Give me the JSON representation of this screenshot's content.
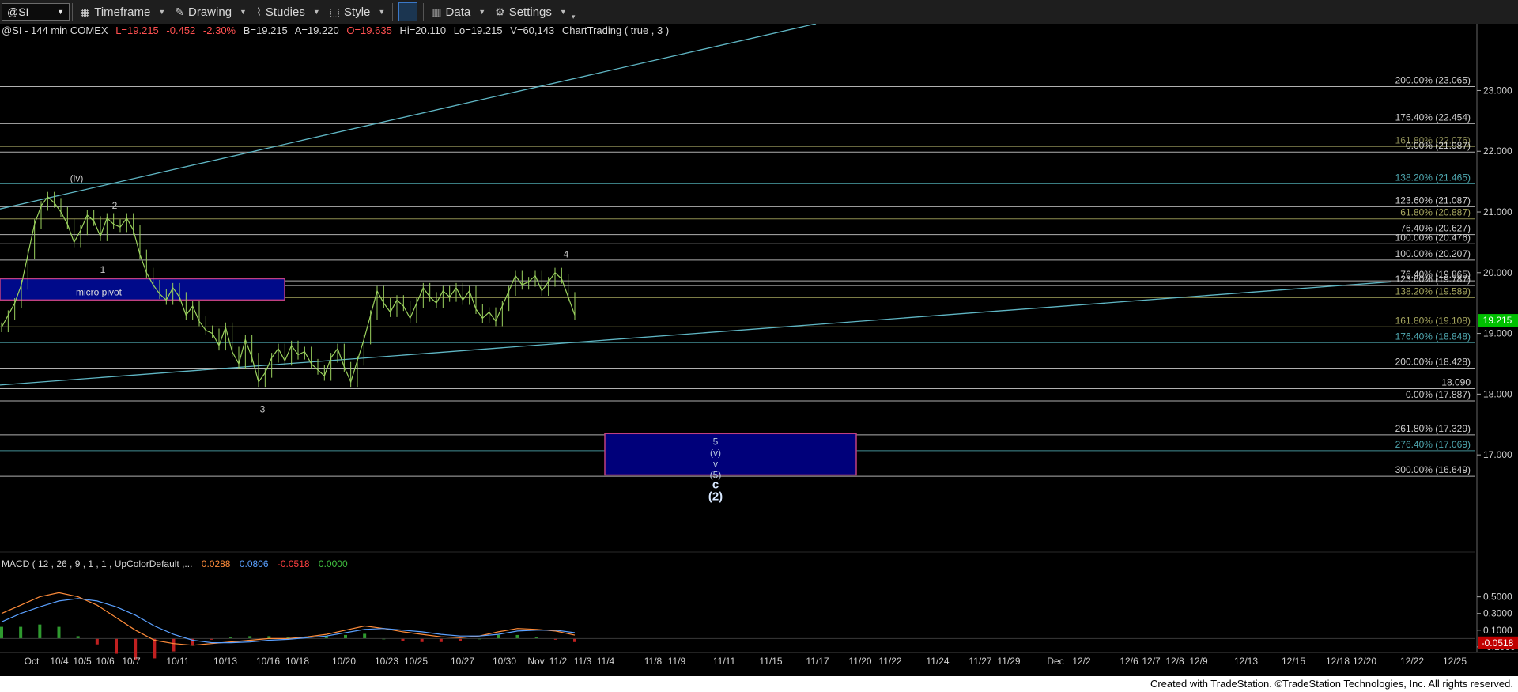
{
  "toolbar": {
    "symbol": "@SI",
    "items": [
      {
        "label": "Timeframe",
        "icon": "calendar-icon"
      },
      {
        "label": "Drawing",
        "icon": "pencil-icon"
      },
      {
        "label": "Studies",
        "icon": "studies-icon"
      },
      {
        "label": "Style",
        "icon": "style-icon"
      },
      {
        "label": "Data",
        "icon": "data-icon"
      },
      {
        "label": "Settings",
        "icon": "gear-icon"
      }
    ]
  },
  "footer": "Created with TradeStation. ©TradeStation Technologies, Inc. All rights reserved.",
  "chart_data": {
    "type": "line",
    "header": {
      "symbol": "@SI - 144 min  COMEX",
      "last": "L=19.215",
      "change": "-0.452",
      "pct": "-2.30%",
      "bid": "B=19.215",
      "ask": "A=19.220",
      "open": "O=19.635",
      "high": "Hi=20.110",
      "low": "Lo=19.215",
      "volume": "V=60,143",
      "study": "ChartTrading ( true , 3 )"
    },
    "colors": {
      "up": "#9bd25e",
      "down": "#e04040",
      "cyan": "#5fb6c4",
      "price_box": "#00c000"
    },
    "ylim": [
      15.4,
      24.1
    ],
    "x_labels": [
      "Oct",
      "10/4",
      "10/5",
      "10/6",
      "10/7",
      "10/11",
      "10/13",
      "10/16",
      "10/18",
      "10/20",
      "10/23",
      "10/25",
      "10/27",
      "10/30",
      "Nov",
      "11/2",
      "11/3",
      "11/4",
      "11/8",
      "11/9",
      "11/11",
      "11/15",
      "11/17",
      "11/20",
      "11/22",
      "11/24",
      "11/27",
      "11/29",
      "Dec",
      "12/2",
      "12/6",
      "12/7",
      "12/8",
      "12/9",
      "12/13",
      "12/15",
      "12/18",
      "12/20",
      "12/22",
      "12/25"
    ],
    "y_ticks": [
      "23.000",
      "22.000",
      "21.000",
      "20.000",
      "19.000",
      "18.000",
      "17.000"
    ],
    "current_price": "19.215",
    "fib_levels": [
      {
        "label": "200.00% (23.065)",
        "value": 23.065,
        "color": "#d0d0d0"
      },
      {
        "label": "176.40% (22.454)",
        "value": 22.454,
        "color": "#d0d0d0"
      },
      {
        "label": "161.80% (22.076)",
        "value": 22.076,
        "color": "#8a8a55"
      },
      {
        "label": "0.00% (21.987)",
        "value": 21.987,
        "color": "#d0d0d0"
      },
      {
        "label": "138.20% (21.465)",
        "value": 21.465,
        "color": "#4fa8b0"
      },
      {
        "label": "123.60% (21.087)",
        "value": 21.087,
        "color": "#d0d0d0"
      },
      {
        "label": "61.80% (20.887)",
        "value": 20.887,
        "color": "#a8a860"
      },
      {
        "label": "76.40% (20.627)",
        "value": 20.627,
        "color": "#d0d0d0"
      },
      {
        "label": "100.00% (20.476)",
        "value": 20.476,
        "color": "#d0d0d0"
      },
      {
        "label": "100.00% (20.207)",
        "value": 20.207,
        "color": "#d0d0d0"
      },
      {
        "label": "76.40% (19.865)",
        "value": 19.865,
        "color": "#d0d0d0"
      },
      {
        "label": "123.60% (19.787)",
        "value": 19.787,
        "color": "#d0d0d0"
      },
      {
        "label": "138.20% (19.589)",
        "value": 19.589,
        "color": "#a8a860"
      },
      {
        "label": "161.80% (19.108)",
        "value": 19.108,
        "color": "#a8a860"
      },
      {
        "label": "176.40% (18.848)",
        "value": 18.848,
        "color": "#4fa8b0"
      },
      {
        "label": "200.00% (18.428)",
        "value": 18.428,
        "color": "#d0d0d0"
      },
      {
        "label": "18.090",
        "value": 18.09,
        "color": "#d0d0d0"
      },
      {
        "label": "0.00% (17.887)",
        "value": 17.887,
        "color": "#d0d0d0"
      },
      {
        "label": "261.80% (17.329)",
        "value": 17.329,
        "color": "#d0d0d0"
      },
      {
        "label": "276.40% (17.069)",
        "value": 17.069,
        "color": "#4fa8b0"
      },
      {
        "label": "300.00% (16.649)",
        "value": 16.649,
        "color": "#d0d0d0"
      }
    ],
    "micro_pivot": {
      "label": "micro pivot",
      "top": 19.9,
      "bottom": 19.55
    },
    "target_box": {
      "top": 17.35,
      "bottom": 16.67,
      "labels": [
        "5",
        "(v)",
        "v",
        "(5)"
      ]
    },
    "wave_labels": [
      {
        "text": "(iv)",
        "value": 21.5
      },
      {
        "text": "2",
        "value": 21.05
      },
      {
        "text": "1",
        "value": 20.0
      },
      {
        "text": "3",
        "value": 17.7
      },
      {
        "text": "4",
        "value": 20.25
      },
      {
        "text": "c",
        "value": 16.45
      },
      {
        "text": "(2)",
        "value": 16.25
      }
    ],
    "trendlines": [
      {
        "from": 21.05,
        "to": 24.1
      },
      {
        "from": 18.15,
        "to": 19.85
      }
    ],
    "price_series": [
      19.1,
      19.3,
      19.5,
      19.8,
      20.3,
      20.8,
      21.1,
      21.25,
      21.15,
      21.0,
      20.8,
      20.5,
      20.7,
      20.95,
      20.85,
      20.6,
      20.9,
      20.8,
      20.75,
      20.9,
      20.7,
      20.3,
      20.0,
      19.8,
      19.65,
      19.55,
      19.75,
      19.6,
      19.3,
      19.45,
      19.2,
      19.05,
      19.0,
      18.8,
      19.1,
      18.7,
      18.5,
      18.9,
      18.6,
      18.2,
      18.35,
      18.6,
      18.75,
      18.55,
      18.8,
      18.65,
      18.7,
      18.5,
      18.4,
      18.3,
      18.6,
      18.75,
      18.45,
      18.2,
      18.55,
      18.9,
      19.3,
      19.7,
      19.5,
      19.35,
      19.55,
      19.45,
      19.25,
      19.5,
      19.75,
      19.6,
      19.5,
      19.7,
      19.6,
      19.75,
      19.55,
      19.7,
      19.4,
      19.25,
      19.35,
      19.2,
      19.45,
      19.7,
      19.95,
      19.8,
      19.85,
      19.95,
      19.7,
      19.85,
      20.0,
      19.9,
      19.6,
      19.3
    ],
    "macd": {
      "label": "MACD ( 12 , 26 , 9 , 1 , 1 , UpColorDefault ,...",
      "values": [
        "0.0288",
        "0.0806",
        "-0.0518",
        "0.0000"
      ],
      "ylim": [
        -0.12,
        0.62
      ],
      "y_ticks": [
        "0.5000",
        "0.3000",
        "0.1000",
        "-0.1000"
      ],
      "current": "-0.0518",
      "macd_line": [
        0.3,
        0.4,
        0.5,
        0.55,
        0.5,
        0.4,
        0.25,
        0.1,
        -0.02,
        -0.06,
        -0.08,
        -0.06,
        -0.04,
        -0.02,
        0.0,
        0.0,
        0.02,
        0.05,
        0.1,
        0.15,
        0.12,
        0.08,
        0.05,
        0.02,
        0.01,
        0.03,
        0.08,
        0.12,
        0.11,
        0.09,
        0.04
      ],
      "signal_line": [
        0.2,
        0.3,
        0.38,
        0.45,
        0.48,
        0.45,
        0.38,
        0.28,
        0.15,
        0.05,
        -0.02,
        -0.05,
        -0.05,
        -0.04,
        -0.02,
        -0.01,
        0.01,
        0.03,
        0.07,
        0.11,
        0.12,
        0.1,
        0.08,
        0.05,
        0.03,
        0.03,
        0.05,
        0.09,
        0.1,
        0.1,
        0.07
      ]
    }
  }
}
